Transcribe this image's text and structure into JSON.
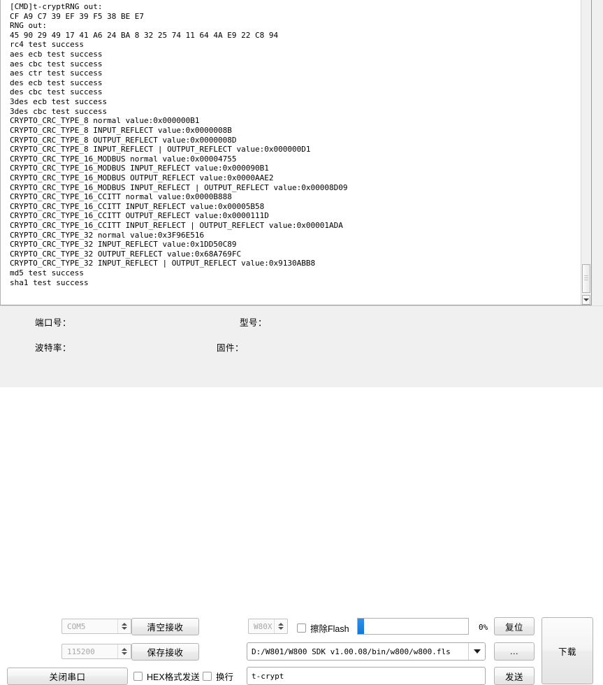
{
  "terminal": {
    "lines": [
      "[CMD]t-cryptRNG out:",
      "CF A9 C7 39 EF 39 F5 38 BE E7",
      "RNG out:",
      "45 90 29 49 17 41 A6 24 BA 8 32 25 74 11 64 4A E9 22 C8 94",
      "rc4 test success",
      "aes ecb test success",
      "aes cbc test success",
      "aes ctr test success",
      "des ecb test success",
      "des cbc test success",
      "3des ecb test success",
      "3des cbc test success",
      "CRYPTO_CRC_TYPE_8 normal value:0x000000B1",
      "CRYPTO_CRC_TYPE_8 INPUT_REFLECT value:0x0000008B",
      "CRYPTO_CRC_TYPE_8 OUTPUT_REFLECT value:0x0000008D",
      "CRYPTO_CRC_TYPE_8 INPUT_REFLECT | OUTPUT_REFLECT value:0x000000D1",
      "CRYPTO_CRC_TYPE_16_MODBUS normal value:0x00004755",
      "CRYPTO_CRC_TYPE_16_MODBUS INPUT_REFLECT value:0x000090B1",
      "CRYPTO_CRC_TYPE_16_MODBUS OUTPUT_REFLECT value:0x0000AAE2",
      "CRYPTO_CRC_TYPE_16_MODBUS INPUT_REFLECT | OUTPUT_REFLECT value:0x00008D09",
      "CRYPTO_CRC_TYPE_16_CCITT normal value:0x0000B888",
      "CRYPTO_CRC_TYPE_16_CCITT INPUT_REFLECT value:0x00005B58",
      "CRYPTO_CRC_TYPE_16_CCITT OUTPUT_REFLECT value:0x0000111D",
      "CRYPTO_CRC_TYPE_16_CCITT INPUT_REFLECT | OUTPUT_REFLECT value:0x00001ADA",
      "CRYPTO_CRC_TYPE_32 normal value:0x3F96E516",
      "CRYPTO_CRC_TYPE_32 INPUT_REFLECT value:0x1DD50C89",
      "CRYPTO_CRC_TYPE_32 OUTPUT_REFLECT value:0x68A769FC",
      "CRYPTO_CRC_TYPE_32 INPUT_REFLECT | OUTPUT_REFLECT value:0x9130ABB8",
      "md5 test success",
      "sha1 test success"
    ]
  },
  "panel": {
    "port_label": "端口号：",
    "port_value": "COM5",
    "baud_label": "波特率：",
    "baud_value": "115200",
    "clear_recv_button": "清空接收",
    "save_recv_button": "保存接收",
    "close_port_button": "关闭串口",
    "hex_send_checkbox": "HEX格式发送",
    "newline_checkbox": "换行",
    "model_label": "型号：",
    "model_value": "W80X",
    "erase_flash_checkbox": "擦除Flash",
    "firmware_label": "固件：",
    "firmware_value": "D:/W801/W800 SDK v1.00.08/bin/w800/w800.fls",
    "send_text_value": "t-crypt",
    "progress_percent": "0%",
    "reset_button": "复位",
    "browse_button": "...",
    "send_button": "发送",
    "download_button": "下载"
  },
  "colors": {
    "accent": "#1277d4",
    "panel_bg": "#f0f0f0",
    "terminal_bg": "#ffffff"
  }
}
